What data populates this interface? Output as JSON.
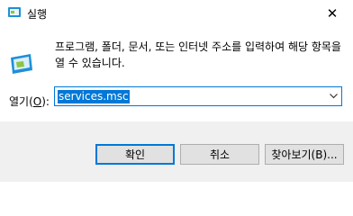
{
  "window": {
    "title": "실행",
    "close_symbol": "✕"
  },
  "dialog": {
    "description": "프로그램, 폴더, 문서, 또는 인터넷 주소를 입력하여 해당 항목을 열 수 있습니다.",
    "open_label_prefix": "열기(",
    "open_label_key": "O",
    "open_label_suffix": "):",
    "input_value": "services.msc"
  },
  "buttons": {
    "ok": "확인",
    "cancel": "취소",
    "browse": "찾아보기(B)..."
  },
  "icons": {
    "app": "run-app-icon",
    "dialog": "run-dialog-icon",
    "dropdown": "chevron-down-icon"
  },
  "colors": {
    "accent": "#0078d7",
    "footer_bg": "#f0f0f0",
    "button_bg": "#e1e1e1",
    "icon_blue": "#1e90d6",
    "icon_green": "#8cc63f"
  }
}
